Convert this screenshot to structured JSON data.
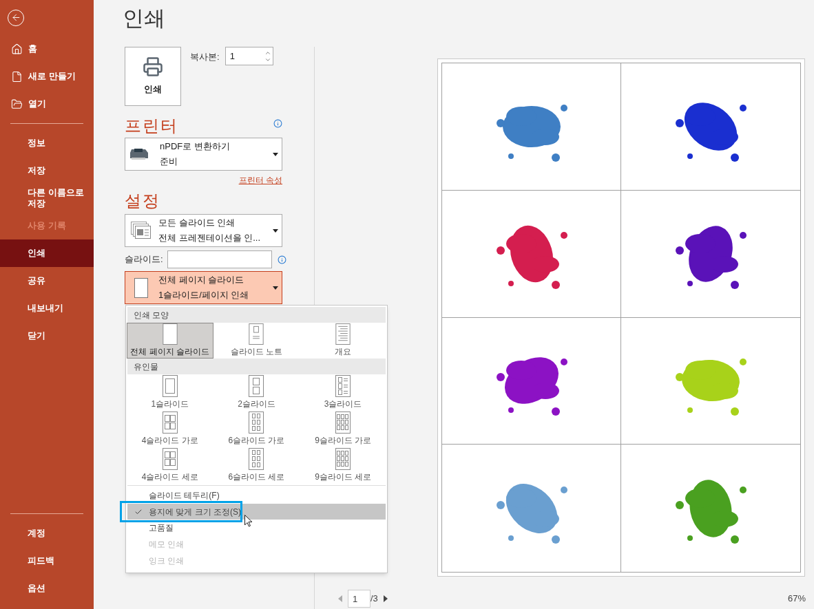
{
  "sidebar": {
    "top_items": [
      {
        "label": "홈",
        "kind": "home",
        "selected": false,
        "disabled": false
      },
      {
        "label": "새로 만들기",
        "kind": "file",
        "selected": false,
        "disabled": false
      },
      {
        "label": "열기",
        "kind": "folder",
        "selected": false,
        "disabled": false
      }
    ],
    "items": [
      {
        "label": "정보",
        "selected": false,
        "disabled": false
      },
      {
        "label": "저장",
        "selected": false,
        "disabled": false
      },
      {
        "label": "다른 이름으로 저장",
        "selected": false,
        "disabled": false
      },
      {
        "label": "사용 기록",
        "selected": false,
        "disabled": true
      },
      {
        "label": "인쇄",
        "selected": true,
        "disabled": false
      },
      {
        "label": "공유",
        "selected": false,
        "disabled": false
      },
      {
        "label": "내보내기",
        "selected": false,
        "disabled": false
      },
      {
        "label": "닫기",
        "selected": false,
        "disabled": false
      }
    ],
    "bottom_items": [
      {
        "label": "계정",
        "selected": false,
        "disabled": false
      },
      {
        "label": "피드백",
        "selected": false,
        "disabled": false
      },
      {
        "label": "옵션",
        "selected": false,
        "disabled": false
      }
    ]
  },
  "title": "인쇄",
  "print_button": {
    "label": "인쇄"
  },
  "copies": {
    "label": "복사본:",
    "value": "1"
  },
  "printer": {
    "heading": "프린터",
    "name": "nPDF로 변환하기",
    "status": "준비",
    "properties_link": "프린터 속성"
  },
  "settings": {
    "heading": "설정",
    "range_dropdown": {
      "title": "모든 슬라이드 인쇄",
      "subtitle": "전체 프레젠테이션을 인...",
      "open": false
    },
    "slides_field": {
      "label": "슬라이드:"
    },
    "layout_dropdown": {
      "title": "전체 페이지 슬라이드",
      "subtitle": "1슬라이드/페이지 인쇄",
      "open": true
    }
  },
  "layout_menu": {
    "sections": [
      {
        "heading": "인쇄 모양",
        "options": [
          {
            "label": "전체 페이지 슬라이드",
            "kind": "full",
            "selected": true
          },
          {
            "label": "슬라이드 노트",
            "kind": "notes",
            "selected": false
          },
          {
            "label": "개요",
            "kind": "outline",
            "selected": false
          }
        ]
      },
      {
        "heading": "유인물",
        "options": [
          {
            "label": "1슬라이드",
            "kind": "one",
            "selected": false
          },
          {
            "label": "2슬라이드",
            "kind": "two",
            "selected": false
          },
          {
            "label": "3슬라이드",
            "kind": "three",
            "selected": false
          },
          {
            "label": "4슬라이드 가로",
            "kind": "four",
            "selected": false
          },
          {
            "label": "6슬라이드 가로",
            "kind": "six",
            "selected": false
          },
          {
            "label": "9슬라이드 가로",
            "kind": "nine",
            "selected": false
          },
          {
            "label": "4슬라이드 세로",
            "kind": "four",
            "selected": false
          },
          {
            "label": "6슬라이드 세로",
            "kind": "six",
            "selected": false
          },
          {
            "label": "9슬라이드 세로",
            "kind": "nine",
            "selected": false
          }
        ]
      }
    ],
    "toggles": [
      {
        "label": "슬라이드 테두리(F)",
        "checked": false,
        "highlighted": false,
        "disabled": false
      },
      {
        "label": "용지에 맞게 크기 조정(S)",
        "checked": true,
        "highlighted": true,
        "disabled": false
      },
      {
        "label": "고품질",
        "checked": false,
        "highlighted": false,
        "disabled": false
      },
      {
        "label": "메모 인쇄",
        "checked": false,
        "highlighted": false,
        "disabled": true
      },
      {
        "label": "잉크 인쇄",
        "checked": false,
        "highlighted": false,
        "disabled": true
      }
    ]
  },
  "pager": {
    "page": "1",
    "total": "/3",
    "zoom": "67%"
  }
}
